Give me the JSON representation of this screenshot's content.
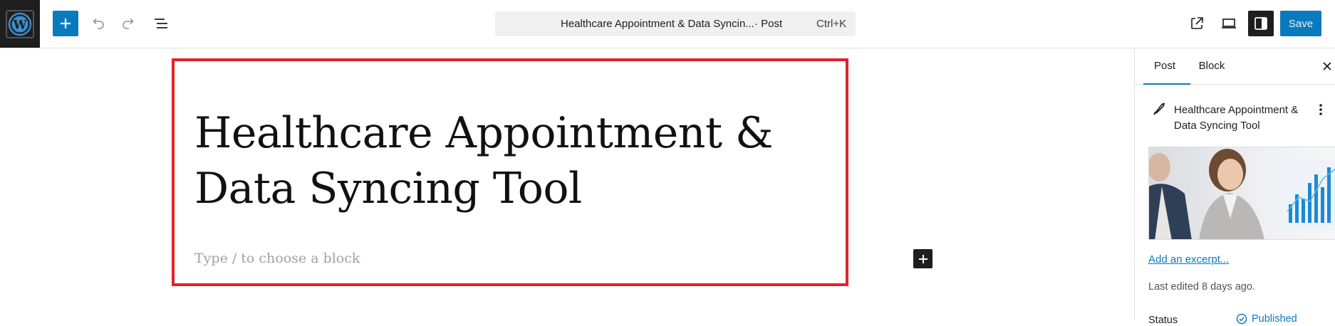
{
  "header": {
    "logo_icon": "wordpress-logo-icon",
    "inserter_icon": "plus-icon",
    "undo_icon": "undo-icon",
    "redo_icon": "redo-icon",
    "list_view_icon": "list-view-icon",
    "command_bar": {
      "title": "Healthcare Appointment & Data Syncin...",
      "post_type": "· Post",
      "shortcut": "Ctrl+K"
    },
    "view_icon": "external-link-icon",
    "preview_icon": "desktop-preview-icon",
    "settings_icon": "sidebar-toggle-icon",
    "save_label": "Save"
  },
  "editor": {
    "title": "Healthcare Appointment & Data Syncing Tool",
    "block_placeholder": "Type / to choose a block",
    "add_block_icon": "plus-icon"
  },
  "sidebar": {
    "tabs": [
      {
        "label": "Post",
        "active": true
      },
      {
        "label": "Block",
        "active": false
      }
    ],
    "close_icon": "close-icon",
    "post_icon": "feather-pen-icon",
    "post_title": "Healthcare Appointment & Data Syncing Tool",
    "more_icon": "more-vertical-icon",
    "excerpt_link": "Add an excerpt...",
    "last_edited": "Last edited 8 days ago.",
    "status_label": "Status",
    "status_value": "Published"
  },
  "colors": {
    "accent": "#0a7abf",
    "highlight_border": "#e3212b",
    "dark": "#1e1e1e"
  }
}
